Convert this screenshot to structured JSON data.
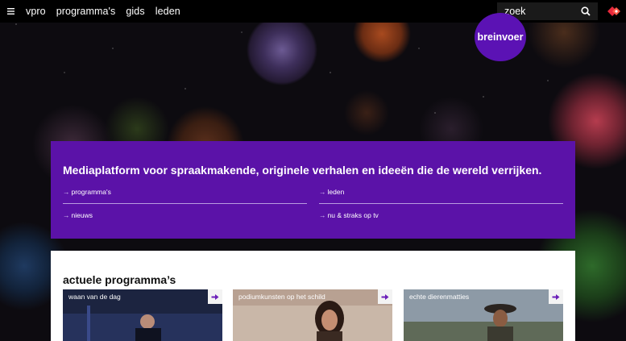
{
  "nav": {
    "items": [
      "vpro",
      "programma's",
      "gids",
      "leden"
    ],
    "search_placeholder": "zoek",
    "menu_icon": "hamburger-icon",
    "search_icon": "search-icon",
    "logo_icon": "vpro-logo-icon"
  },
  "badge": {
    "label": "breinvoer",
    "color": "#5b12b4"
  },
  "hero": {
    "title": "Mediaplatform voor spraakmakende, originele verhalen en ideeën die de wereld verrijken.",
    "links": [
      {
        "label": "programma's"
      },
      {
        "label": "leden"
      },
      {
        "label": "nieuws"
      },
      {
        "label": "nu & straks op tv"
      }
    ],
    "color": "#5b12a8"
  },
  "programs": {
    "heading": "actuele programma’s",
    "cards": [
      {
        "title": "waan van de dag"
      },
      {
        "title": "podiumkunsten op het schild"
      },
      {
        "title": "echte dierenmatties"
      }
    ],
    "accent": "#6b1fb8"
  }
}
